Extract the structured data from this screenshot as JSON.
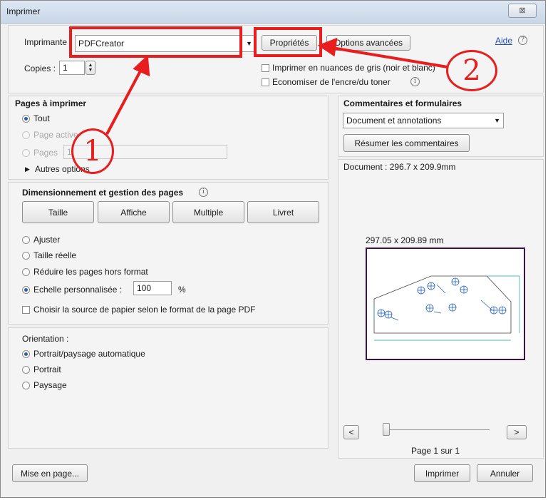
{
  "window": {
    "title": "Imprimer",
    "close_glyph": "⊠"
  },
  "printer": {
    "label": "Imprimante :",
    "selected": "PDFCreator",
    "properties_button": "Propriétés",
    "advanced_button": "Options avancées",
    "help_link": "Aide",
    "copies_label": "Copies :",
    "copies_value": "1",
    "grayscale_label": "Imprimer en nuances de gris (noir et blanc)",
    "ink_saver_label": "Economiser de l'encre/du toner"
  },
  "pages_to_print": {
    "heading": "Pages à imprimer",
    "all": "Tout",
    "current_page": "Page active",
    "pages": "Pages",
    "pages_value": "1",
    "more_options": "Autres options"
  },
  "sizing": {
    "heading": "Dimensionnement et gestion des pages",
    "tabs": [
      "Taille",
      "Affiche",
      "Multiple",
      "Livret"
    ],
    "fit": "Ajuster",
    "actual_size": "Taille réelle",
    "shrink": "Réduire les pages hors format",
    "custom_scale": "Echelle personnalisée :",
    "custom_scale_value": "100",
    "percent": "%",
    "paper_source": "Choisir la source de papier selon le format de la page PDF"
  },
  "orientation": {
    "heading": "Orientation :",
    "auto": "Portrait/paysage automatique",
    "portrait": "Portrait",
    "landscape": "Paysage"
  },
  "comments": {
    "heading": "Commentaires et formulaires",
    "selected": "Document et annotations",
    "summarize_button": "Résumer les commentaires"
  },
  "preview": {
    "document_size": "Document : 296.7 x 209.9mm",
    "page_size": "297.05 x 209.89 mm",
    "prev_button": "<",
    "next_button": ">",
    "page_indicator": "Page 1 sur 1"
  },
  "footer": {
    "page_setup_button": "Mise en page...",
    "print_button": "Imprimer",
    "cancel_button": "Annuler"
  },
  "annotations": {
    "marker_1": "1",
    "marker_2": "2"
  },
  "colors": {
    "annotation_red": "#e81e1e",
    "title_bar": "#c9d7e8"
  }
}
